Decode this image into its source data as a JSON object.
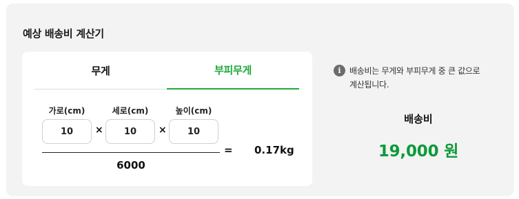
{
  "title": "예상 배송비 계산기",
  "tabs": [
    {
      "label": "무게",
      "active": false
    },
    {
      "label": "부피무게",
      "active": true
    }
  ],
  "dimensions": {
    "width": {
      "label": "가로(cm)",
      "value": "10"
    },
    "depth": {
      "label": "세로(cm)",
      "value": "10"
    },
    "height": {
      "label": "높이(cm)",
      "value": "10"
    }
  },
  "formula": {
    "multiply": "×",
    "equals": "=",
    "divisor": "6000",
    "result": "0.17kg"
  },
  "info": {
    "icon": "info-icon",
    "icon_glyph": "i",
    "text_line1": "배송비는 무게와 부피무게 중 큰 값으로",
    "text_line2": "계산됩니다."
  },
  "fee": {
    "label": "배송비",
    "value": "19,000 원"
  },
  "colors": {
    "accent": "#1faa3a",
    "fee": "#0d9a3a",
    "panel_bg": "#f3f3f3"
  }
}
